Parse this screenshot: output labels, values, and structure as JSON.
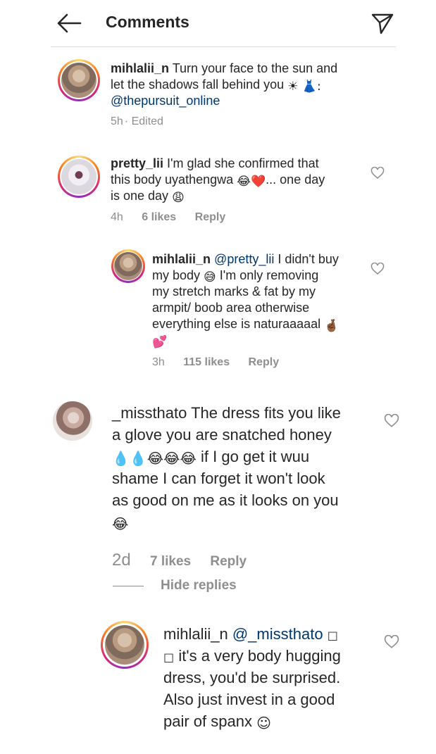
{
  "header": {
    "title": "Comments"
  },
  "comments": [
    {
      "username": "mihlalii_n",
      "text_lines": [
        "Turn your face to the sun and",
        "let the shadows fall behind you ☀ 👗:",
        "@thepursuit_online"
      ],
      "line1_rest": "Turn your face to the sun and",
      "line2": "let the shadows fall behind you",
      "emoji2": "☀ 👗:",
      "mention": "@thepursuit_online",
      "time": "5h",
      "edited": "· Edited"
    },
    {
      "username": "pretty_lii",
      "line1_rest": "I'm glad she confirmed that",
      "line2": "this body uyathengwa",
      "emoji2": "😂❤️",
      "line2_tail": "... one day",
      "line3": "is one day",
      "emoji3": "😩",
      "time": "4h",
      "likes": "6 likes",
      "reply": "Reply"
    },
    {
      "username": "mihlalii_n",
      "mention": "@pretty_lii",
      "line1_rest": "I didn't buy",
      "line2": "my body",
      "emoji2": "😅",
      "line2_tail": "I'm only removing",
      "line3": "my stretch marks & fat by my",
      "line4": "armpit/ boob area otherwise",
      "line5": "everything else is naturaaaaal",
      "emoji5": "🤞🏾",
      "emoji6": "💕",
      "time": "3h",
      "likes": "115 likes",
      "reply": "Reply"
    },
    {
      "username": "_missthato",
      "line1_rest": "The dress fits you like",
      "line2": "a glove you are snatched honey",
      "emoji3": "💧💧😂😂😂",
      "line3_tail": "if I go get it wuu",
      "line4": "shame I can forget it won't look",
      "line5": "as good on me as it looks on you",
      "emoji6": "😂",
      "time": "2d",
      "likes": "7 likes",
      "reply": "Reply",
      "hide_replies": "Hide replies"
    },
    {
      "username": "mihlalii_n",
      "mention": "@_missthato",
      "emoji1": "☐",
      "emoji2a": "☐",
      "line2": "it's a very body hugging",
      "line3": "dress, you'd be surprised.",
      "line4": "Also just invest in a good",
      "line5": "pair of spanx",
      "emoji5": "☺"
    }
  ]
}
